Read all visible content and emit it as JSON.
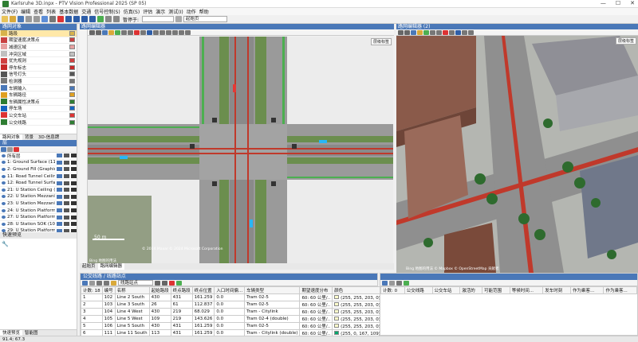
{
  "window": {
    "title": "Karlsruhe 3D.inpx - PTV Vision Professional 2025 (SP 05)",
    "controls": [
      "—",
      "☐",
      "✕"
    ]
  },
  "menu": [
    "文件(F)",
    "编辑",
    "查看",
    "列表",
    "基本数据",
    "交通",
    "信号控制(S)",
    "仿真(S)",
    "评估",
    "演示",
    "测试(I)",
    "动作",
    "帮助"
  ],
  "toolbar": {
    "pause_label": "暂停于:",
    "view_combo": "起始页"
  },
  "left_panel": {
    "title": "路网对象",
    "items": [
      {
        "label": "路段",
        "icon_color": "#d7b24a",
        "selected": true
      },
      {
        "label": "期望速度决策点",
        "icon_color": "#c94040"
      },
      {
        "label": "减速区域",
        "icon_color": "#e6a0a0"
      },
      {
        "label": "冲突区域",
        "icon_color": "#c0c0c0"
      },
      {
        "label": "优先规则",
        "icon_color": "#d04040"
      },
      {
        "label": "停车标志",
        "icon_color": "#c62828"
      },
      {
        "label": "信号灯头",
        "icon_color": "#555555"
      },
      {
        "label": "检测器",
        "icon_color": "#777777"
      },
      {
        "label": "车辆输入",
        "icon_color": "#4a78b8"
      },
      {
        "label": "车辆路径",
        "icon_color": "#e0a020"
      },
      {
        "label": "车辆属性决策点",
        "icon_color": "#2e7d32"
      },
      {
        "label": "停车场",
        "icon_color": "#1565c0"
      },
      {
        "label": "公交车站",
        "icon_color": "#d33"
      },
      {
        "label": "公交线路",
        "icon_color": "#2e7d32"
      }
    ],
    "tabs": [
      "路网对象",
      "背景",
      "3D-信息牌"
    ]
  },
  "levels_panel": {
    "title": "层",
    "rows": [
      "所有层",
      "1: Ground Surface (1147)",
      "2: Ground Fill (Graphics...",
      "11: Road Tunnel Ceiling...",
      "12: Road Tunnel Surfac...",
      "21: U Station Ceiling (3...",
      "22: U Station Mezzanin...",
      "23: U Station Mezzanin...",
      "24: U Station Platform ...",
      "27: U Station Platform ...",
      "28: U Station SOK (101...",
      "29: U Station Platform ..."
    ]
  },
  "quick_view": {
    "title": "快速预览",
    "tabs": [
      "快速预览",
      "智能图"
    ]
  },
  "editor_2d": {
    "title": "路网编辑器",
    "bottom_tabs": [
      "起始页",
      "路网编辑器"
    ],
    "scale": "50 m",
    "overlay_btn": "层级标签",
    "attribution": "© 2024 Maxar © 2024 Microsoft Corporation",
    "bing_label": "Bing 地图的用法"
  },
  "editor_3d": {
    "title": "路网编辑器 (2)",
    "overlay_btn": "层级标签",
    "attribution": "Bing 地图的用法 © Mapbox © OpenStreetMap 贡献者"
  },
  "lines_panel": {
    "title": "公交线路 / 线路站点",
    "dropdown": "线路站点",
    "count_label": "计数: 18",
    "columns": [
      "编号",
      "名称",
      "起始路段",
      "终点路段",
      "终点位置",
      "入口时间偏...",
      "车辆类型",
      "期望速度分布",
      "颜色"
    ],
    "rows": [
      {
        "n": "1",
        "no": "102",
        "name": "Line 2 South",
        "from": "430",
        "to": "431",
        "pos": "161.259",
        "off": "0.0",
        "veh": "Tram 02-5",
        "spd": "60: 60 公里/..",
        "color": "(255, 255, 203, 0)",
        "sw": "#ffffcb"
      },
      {
        "n": "2",
        "no": "103",
        "name": "Line 3 South",
        "from": "26",
        "to": "61",
        "pos": "112.837",
        "off": "0.0",
        "veh": "Tram 02-5",
        "spd": "60: 60 公里/..",
        "color": "(255, 255, 203, 0)",
        "sw": "#ffffcb"
      },
      {
        "n": "3",
        "no": "104",
        "name": "Line 4 West",
        "from": "430",
        "to": "219",
        "pos": "68.029",
        "off": "0.0",
        "veh": "Tram - Citylink",
        "spd": "60: 60 公里/..",
        "color": "(255, 255, 203, 0)",
        "sw": "#ffffcb"
      },
      {
        "n": "4",
        "no": "105",
        "name": "Line 5 West",
        "from": "109",
        "to": "219",
        "pos": "143.626",
        "off": "0.0",
        "veh": "Tram 02-4 (double)",
        "spd": "60: 60 公里/..",
        "color": "(255, 255, 203, 0)",
        "sw": "#ffffcb"
      },
      {
        "n": "5",
        "no": "106",
        "name": "Line 5 South",
        "from": "430",
        "to": "431",
        "pos": "161.259",
        "off": "0.0",
        "veh": "Tram 02-5",
        "spd": "60: 60 公里/..",
        "color": "(255, 255, 203, 0)",
        "sw": "#ffffcb"
      },
      {
        "n": "6",
        "no": "111",
        "name": "Line 11 South",
        "from": "113",
        "to": "431",
        "pos": "161.259",
        "off": "0.0",
        "veh": "Tram - Citylink (double)",
        "spd": "60: 60 公里/..",
        "color": "(255, 0, 167, 109)",
        "sw": "#00a76d"
      }
    ]
  },
  "stops_panel": {
    "count_label": "计数: 0",
    "columns": [
      "公交线路",
      "公交车站",
      "激活的",
      "可能范围",
      "等候时间...",
      "发车时刻",
      "作为乘客...",
      "作为乘客..."
    ]
  },
  "status": "91.4; 67.3",
  "colors": {
    "accent": "#4a78b8",
    "road": "#8a8a8a",
    "grass": "#6b8e4e",
    "tram": "#c0392b"
  }
}
